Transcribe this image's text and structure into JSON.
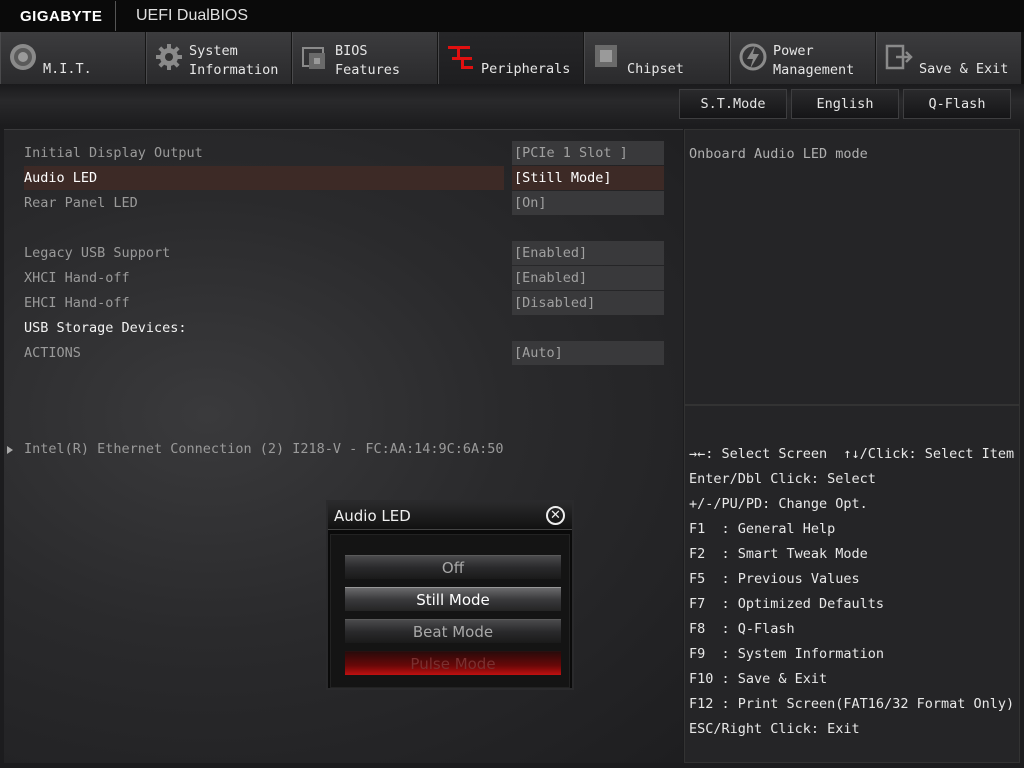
{
  "topbar": {
    "brand": "GIGABYTE",
    "title": "UEFI DualBIOS"
  },
  "tabs": [
    {
      "line1": "",
      "line2": "M.I.T.",
      "icon": "mit-dial-icon"
    },
    {
      "line1": "System",
      "line2": "Information",
      "icon": "gear-icon"
    },
    {
      "line1": "BIOS",
      "line2": "Features",
      "icon": "bios-chip-icon"
    },
    {
      "line1": "",
      "line2": "Peripherals",
      "icon": "peripherals-icon"
    },
    {
      "line1": "",
      "line2": "Chipset",
      "icon": "chipset-icon"
    },
    {
      "line1": "Power",
      "line2": "Management",
      "icon": "power-icon"
    },
    {
      "line1": "",
      "line2": "Save & Exit",
      "icon": "exit-icon"
    }
  ],
  "subbar": {
    "st_mode": "S.T.Mode",
    "language": "English",
    "qflash": "Q-Flash"
  },
  "settings": [
    {
      "label": "Initial Display Output",
      "value": "[PCIe 1 Slot ]"
    },
    {
      "label": "Audio LED",
      "value": "[Still Mode]"
    },
    {
      "label": "Rear Panel LED",
      "value": "[On]"
    },
    {
      "label": "Legacy USB Support",
      "value": "[Enabled]"
    },
    {
      "label": "XHCI Hand-off",
      "value": "[Enabled]"
    },
    {
      "label": "EHCI Hand-off",
      "value": "[Disabled]"
    },
    {
      "label": "USB Storage Devices:"
    },
    {
      "label": "ACTIONS",
      "value": "[Auto]"
    }
  ],
  "ethernet": "Intel(R) Ethernet Connection (2) I218-V - FC:AA:14:9C:6A:50",
  "help": {
    "description": "Onboard Audio LED mode"
  },
  "keys": [
    "→←: Select Screen  ↑↓/Click: Select Item",
    "Enter/Dbl Click: Select",
    "+/-/PU/PD: Change Opt.",
    "F1  : General Help",
    "F2  : Smart Tweak Mode",
    "F5  : Previous Values",
    "F7  : Optimized Defaults",
    "F8  : Q-Flash",
    "F9  : System Information",
    "F10 : Save & Exit",
    "F12 : Print Screen(FAT16/32 Format Only)",
    "ESC/Right Click: Exit"
  ],
  "popup": {
    "title": "Audio LED",
    "options": [
      "Off",
      "Still Mode",
      "Beat Mode",
      "Pulse Mode"
    ]
  },
  "colors": {
    "accent": "#e01010",
    "selected_row": "#3d2a26"
  }
}
